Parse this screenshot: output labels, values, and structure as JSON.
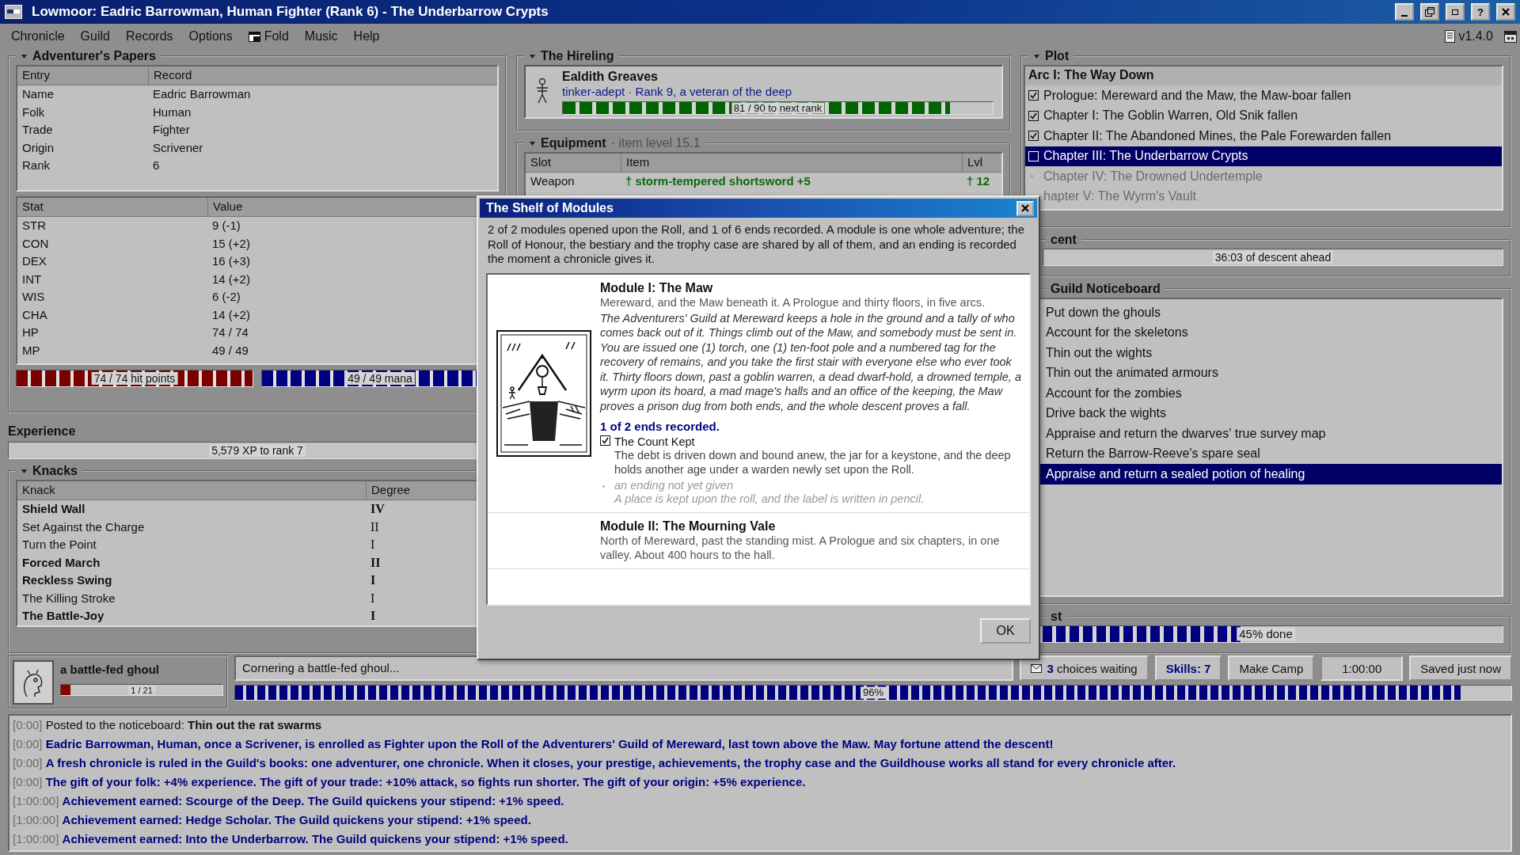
{
  "window": {
    "title": "Lowmoor: Eadric Barrowman, Human Fighter (Rank 6) - The Underbarrow Crypts",
    "buttons": [
      {
        "kind": "minimize"
      },
      {
        "kind": "restore"
      },
      {
        "kind": "maximize"
      },
      {
        "kind": "help",
        "label": "?"
      },
      {
        "kind": "close"
      }
    ]
  },
  "menu": [
    {
      "label": "Chronicle",
      "kind": "plain"
    },
    {
      "label": "Guild",
      "kind": "plain"
    },
    {
      "label": "Records",
      "kind": "plain"
    },
    {
      "label": "Options",
      "kind": "plain"
    },
    {
      "label": "Fold",
      "kind": "icon"
    },
    {
      "label": "Music",
      "kind": "plain"
    },
    {
      "label": "Help",
      "kind": "plain"
    }
  ],
  "version": "v1.4.0",
  "papers": {
    "title": "Adventurer's Papers",
    "entries": {
      "columns": [
        "Entry",
        "Record"
      ],
      "rows": [
        [
          "Name",
          "Eadric Barrowman"
        ],
        [
          "Folk",
          "Human"
        ],
        [
          "Trade",
          "Fighter"
        ],
        [
          "Origin",
          "Scrivener"
        ],
        [
          "Rank",
          "6"
        ]
      ]
    },
    "stats": {
      "columns": [
        "Stat",
        "Value"
      ],
      "rows": [
        [
          "STR",
          "9 (-1)"
        ],
        [
          "CON",
          "15 (+2)"
        ],
        [
          "DEX",
          "16 (+3)"
        ],
        [
          "INT",
          "14 (+2)"
        ],
        [
          "WIS",
          "6 (-2)"
        ],
        [
          "CHA",
          "14 (+2)"
        ],
        [
          "HP",
          "74 / 74"
        ],
        [
          "MP",
          "49 / 49"
        ]
      ]
    },
    "hp": {
      "text": "74 / 74 hit points",
      "level": 1
    },
    "mana": {
      "text": "49 / 49 mana",
      "level": 1
    }
  },
  "experience": {
    "title": "Experience",
    "text": "5,579 XP to rank 7"
  },
  "knacks": {
    "title": "Knacks",
    "columns": [
      "Knack",
      "Degree"
    ],
    "rows": [
      {
        "name": "Shield Wall",
        "degree": "IV",
        "bold": true
      },
      {
        "name": "Set Against the Charge",
        "degree": "II",
        "bold": false
      },
      {
        "name": "Turn the Point",
        "degree": "I",
        "bold": false
      },
      {
        "name": "Forced March",
        "degree": "II",
        "bold": true
      },
      {
        "name": "Reckless Swing",
        "degree": "I",
        "bold": true
      },
      {
        "name": "The Killing Stroke",
        "degree": "I",
        "bold": false
      },
      {
        "name": "The Battle-Joy",
        "degree": "I",
        "bold": true
      }
    ]
  },
  "hireling": {
    "title": "The Hireling",
    "name": "Ealdith Greaves",
    "line": "tinker-adept · Rank 9, a veteran of the deep",
    "bar": {
      "text": "81 / 90 to next rank",
      "level": 0.9
    }
  },
  "equipment": {
    "title": "Equipment",
    "note": "· item level 15.1",
    "columns": [
      "Slot",
      "Item",
      "Lvl"
    ],
    "rows": [
      {
        "slot": "Weapon",
        "item": "† storm-tempered shortsword +5",
        "lvl": "† 12"
      }
    ]
  },
  "plot": {
    "title": "Plot",
    "arc": "Arc I: The Way Down",
    "chapters": [
      {
        "label": "Prologue: Mereward and the Maw, the Maw-boar fallen",
        "checked": true,
        "selected": false,
        "locked": false
      },
      {
        "label": "Chapter I: The Goblin Warren, Old Snik fallen",
        "checked": true,
        "selected": false,
        "locked": false
      },
      {
        "label": "Chapter II: The Abandoned Mines, the Pale Forewarden fallen",
        "checked": true,
        "selected": false,
        "locked": false
      },
      {
        "label": "Chapter III: The Underbarrow Crypts",
        "checked": false,
        "selected": true,
        "locked": false
      },
      {
        "label": "Chapter IV: The Drowned Undertemple",
        "selected": false,
        "locked": true
      },
      {
        "label": "hapter V: The Wyrm's Vault",
        "selected": false,
        "locked": true
      }
    ]
  },
  "descent": {
    "title": "cent",
    "text": "36:03 of descent ahead"
  },
  "noticeboard": {
    "title": "Guild Noticeboard",
    "items": [
      {
        "label": "Put down the ghouls",
        "selected": false
      },
      {
        "label": "Account for the skeletons",
        "selected": false
      },
      {
        "label": "Thin out the wights",
        "selected": false
      },
      {
        "label": "Thin out the animated armours",
        "selected": false
      },
      {
        "label": "Account for the zombies",
        "selected": false
      },
      {
        "label": "Drive back the wights",
        "selected": false
      },
      {
        "label": "Appraise and return the dwarves' true survey map",
        "selected": false
      },
      {
        "label": "Return the Barrow-Reeve's spare seal",
        "selected": false
      },
      {
        "label": "Appraise and return a sealed potion of healing",
        "selected": true
      }
    ]
  },
  "quest": {
    "title": "st",
    "text": "45% done",
    "level": 0.45
  },
  "foe": {
    "name": "a battle-fed ghoul",
    "text": "1 / 21",
    "level": 0.06
  },
  "activity": {
    "text": "Cornering a battle-fed ghoul...",
    "progress_text": "96%",
    "level": 0.96
  },
  "status_buttons": [
    {
      "kind": "mail",
      "label": "**3** choices waiting"
    },
    {
      "kind": "skills",
      "label": "Skills: 7"
    },
    {
      "kind": "plain",
      "label": "Make Camp"
    },
    {
      "kind": "readout",
      "label": "1:00:00"
    },
    {
      "kind": "plain",
      "label": "Saved just now"
    }
  ],
  "log": [
    {
      "time": "[0:00]",
      "text": "Posted to the noticeboard: **Thin out the rat swarms**",
      "kind": "notice"
    },
    {
      "time": "[0:00]",
      "text": "Eadric Barrowman, Human, once a Scrivener, is enrolled as Fighter upon the Roll of the Adventurers' Guild of Mereward, last town above the Maw. May fortune attend the descent!",
      "kind": "event"
    },
    {
      "time": "[0:00]",
      "text": "A fresh chronicle is ruled in the Guild's books: one adventurer, one chronicle. When it closes, your prestige, achievements, the trophy case and the Guildhouse works all stand for every chronicle after.",
      "kind": "event"
    },
    {
      "time": "[0:00]",
      "text": "The gift of your folk: +4% experience. The gift of your trade: +10% attack, so fights run shorter. The gift of your origin: +5% experience.",
      "kind": "event"
    },
    {
      "time": "[1:00:00]",
      "text": "Achievement earned: Scourge of the Deep. The Guild quickens your stipend: +1% speed.",
      "kind": "event"
    },
    {
      "time": "[1:00:00]",
      "text": "Achievement earned: Hedge Scholar. The Guild quickens your stipend: +1% speed.",
      "kind": "event"
    },
    {
      "time": "[1:00:00]",
      "text": "Achievement earned: Into the Underbarrow. The Guild quickens your stipend: +1% speed.",
      "kind": "event"
    }
  ],
  "dialog": {
    "title": "The Shelf of Modules",
    "intro": "2 of 2 modules opened upon the Roll, and 1 of 6 ends recorded. A module is one whole adventure; the Roll of Honour, the bestiary and the trophy case are shared by all of them, and an ending is recorded the moment a chronicle gives it.",
    "modules": [
      {
        "title": "Module I: The Maw",
        "kind": "illustrated",
        "subtitle": "Mereward, and the Maw beneath it. A Prologue and thirty floors, in five arcs.",
        "description": "The Adventurers' Guild at Mereward keeps a hole in the ground and a tally of who comes back out of it. Things climb out of the Maw, and somebody must be sent in. You are issued one (1) torch, one (1) ten-foot pole and a numbered tag for the recovery of remains, and you take the first stair with everyone else who ever took it. Thirty floors down, past a goblin warren, a dead dwarf-hold, a drowned temple, a wyrm upon its hoard, a mad mage's halls and an office of the keeping, the Maw proves a prison dug from both ends, and the whole descent proves a fall.",
        "ends_summary": "1 of 2 ends recorded.",
        "endings": [
          {
            "name": "The Count Kept",
            "text": "The debt is driven down and bound anew, the jar for a keystone, and the deep holds another age under a warden newly set upon the Roll.",
            "recorded": true
          },
          {
            "name": "an ending not yet given",
            "text": "A place is kept upon the roll, and the label is written in pencil.",
            "recorded": false
          }
        ]
      },
      {
        "title": "Module II: The Mourning Vale",
        "kind": "plain",
        "subtitle": "North of Mereward, past the standing mist. A Prologue and six chapters, in one valley. About 400 hours to the hall."
      }
    ],
    "ok": "OK"
  }
}
